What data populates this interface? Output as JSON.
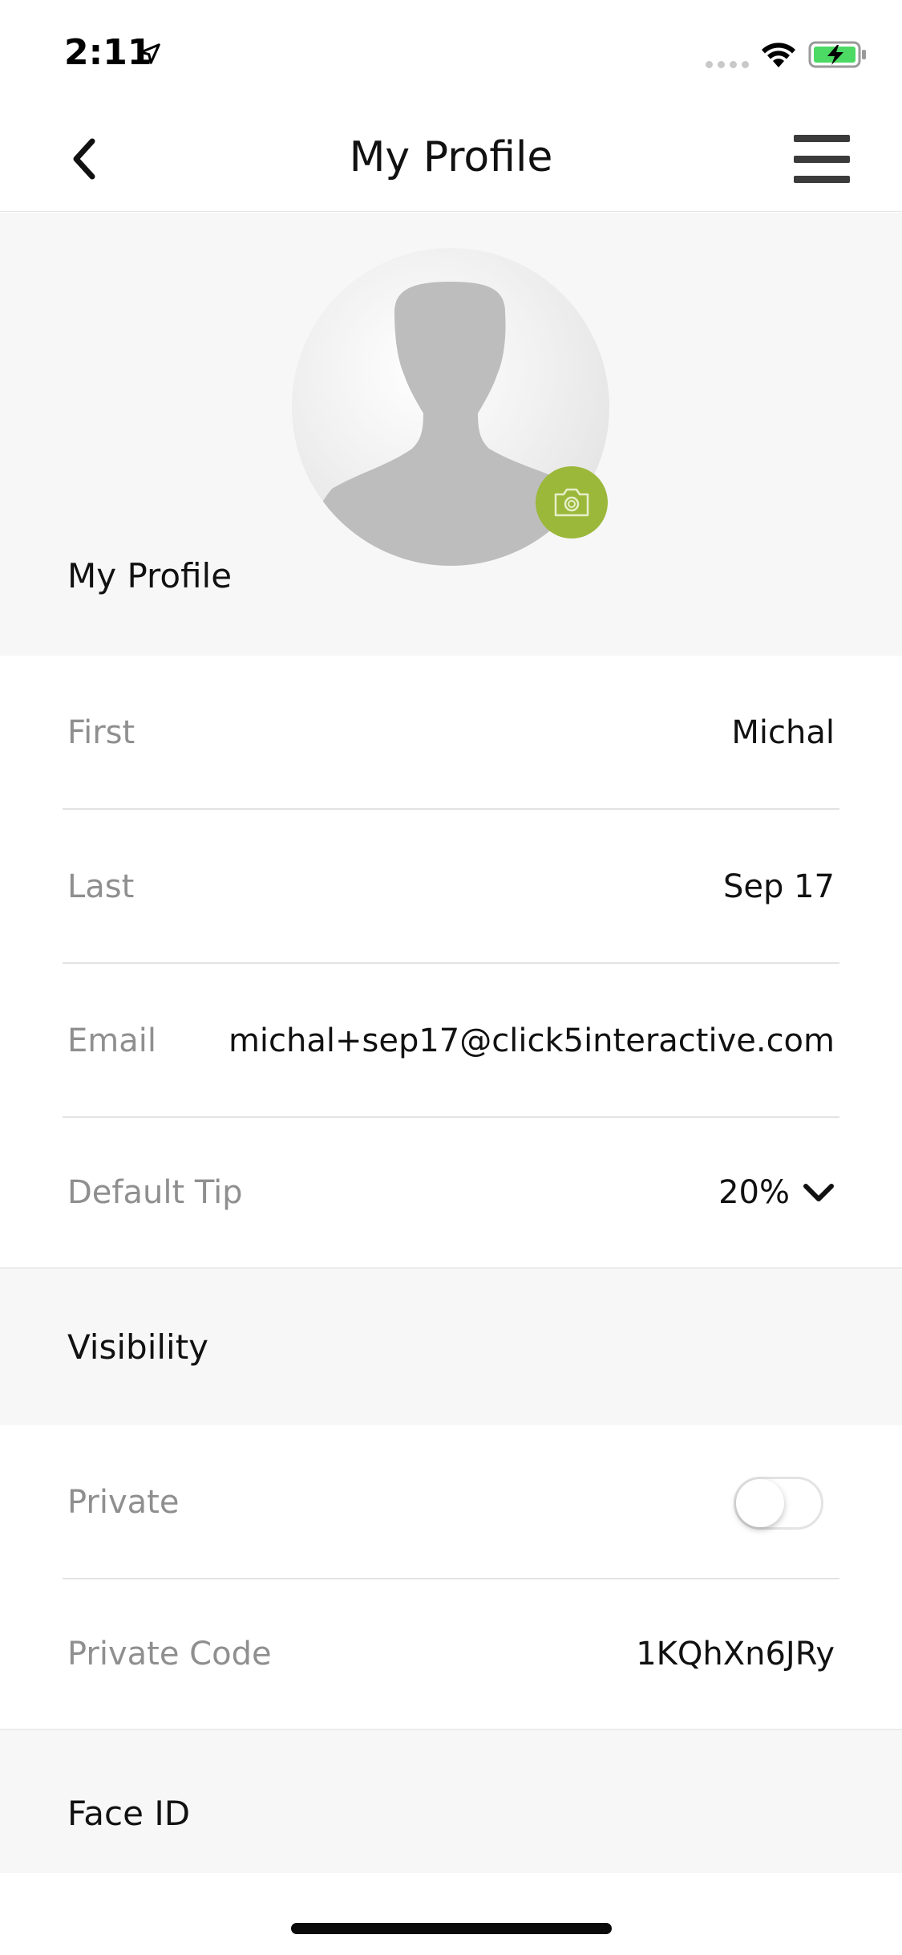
{
  "status_bar": {
    "time": "2:11"
  },
  "nav": {
    "title": "My Profile"
  },
  "profile_header": {
    "heading": "My Profile"
  },
  "fields": {
    "first": {
      "label": "First",
      "value": "Michal"
    },
    "last": {
      "label": "Last",
      "value": "Sep 17"
    },
    "email": {
      "label": "Email",
      "value": "michal+sep17@click5interactive.com"
    },
    "default_tip": {
      "label": "Default Tip",
      "value": "20%"
    }
  },
  "visibility": {
    "title": "Visibility",
    "private": {
      "label": "Private",
      "enabled": false
    },
    "private_code": {
      "label": "Private Code",
      "value": "1KQhXn6JRy"
    }
  },
  "face_id": {
    "title": "Face ID"
  },
  "colors": {
    "accent": "#9bb83a",
    "battery_fill": "#4cd964",
    "section_background": "#f7f7f7",
    "label_gray": "#8f8f8f"
  },
  "icons": [
    "location-arrow-icon",
    "signal-icon",
    "wifi-icon",
    "battery-charging-icon",
    "chevron-left-icon",
    "hamburger-menu-icon",
    "camera-icon",
    "chevron-down-icon"
  ]
}
